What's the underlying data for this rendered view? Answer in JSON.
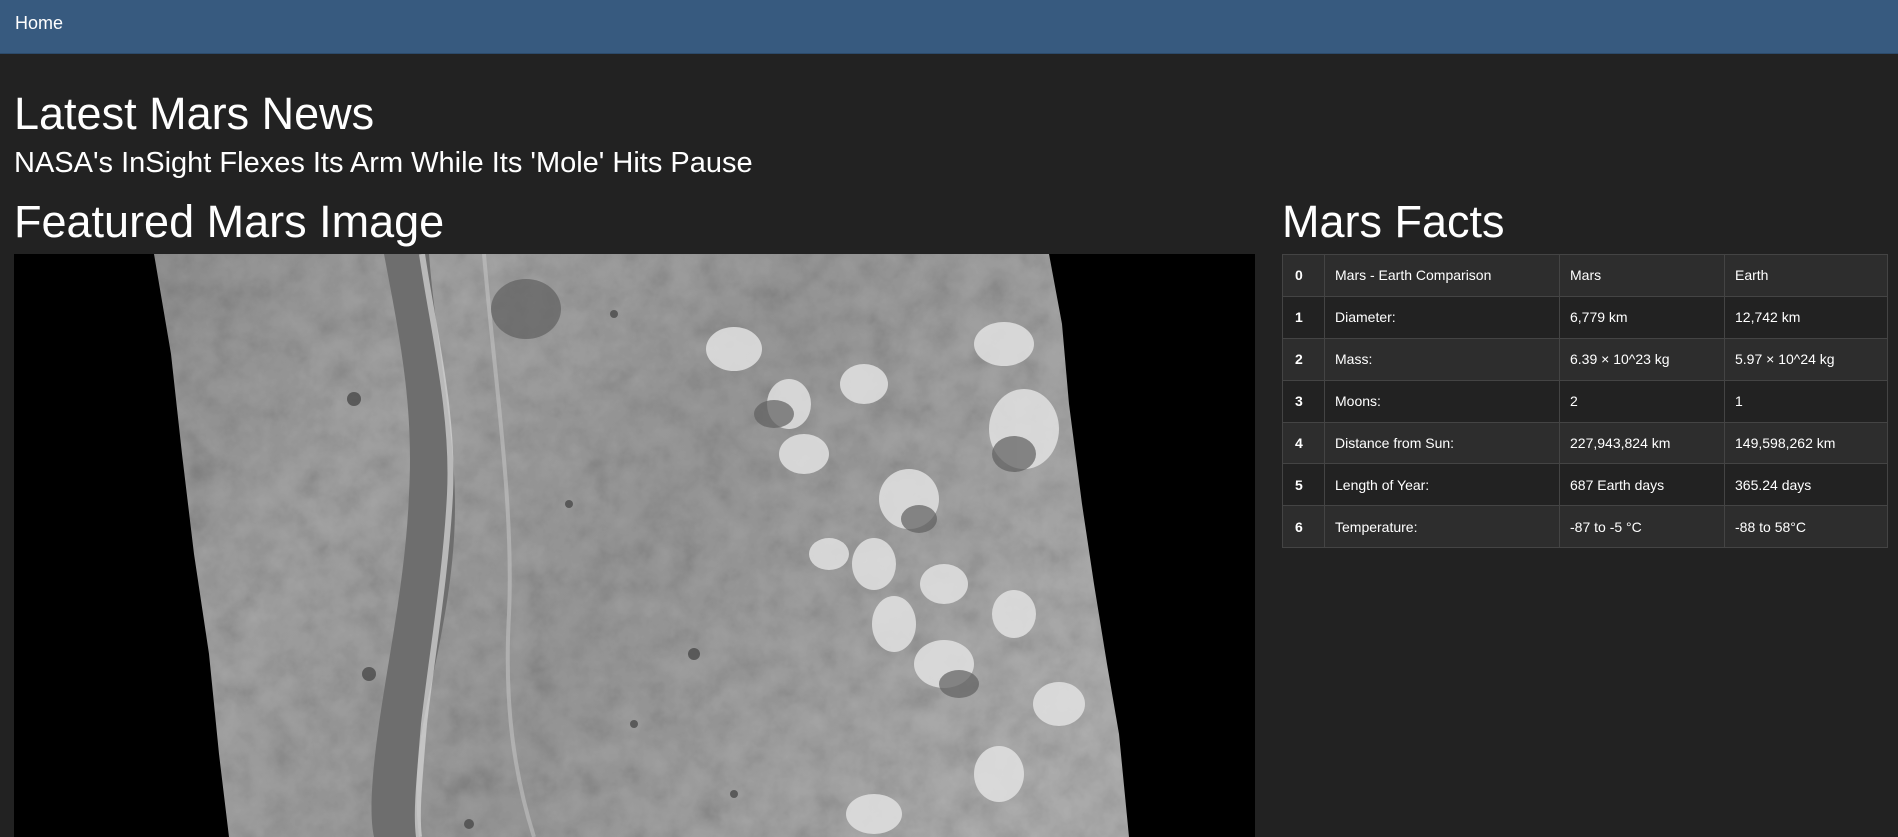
{
  "nav": {
    "home_label": "Home"
  },
  "news": {
    "heading": "Latest Mars News",
    "title": "NASA's InSight Flexes Its Arm While Its 'Mole' Hits Pause"
  },
  "featured": {
    "heading": "Featured Mars Image"
  },
  "facts": {
    "heading": "Mars Facts",
    "rows": [
      {
        "index": "0",
        "label": "Mars - Earth Comparison",
        "mars": "Mars",
        "earth": "Earth"
      },
      {
        "index": "1",
        "label": "Diameter:",
        "mars": "6,779 km",
        "earth": "12,742 km"
      },
      {
        "index": "2",
        "label": "Mass:",
        "mars": "6.39 × 10^23 kg",
        "earth": "5.97 × 10^24 kg"
      },
      {
        "index": "3",
        "label": "Moons:",
        "mars": "2",
        "earth": "1"
      },
      {
        "index": "4",
        "label": "Distance from Sun:",
        "mars": "227,943,824 km",
        "earth": "149,598,262 km"
      },
      {
        "index": "5",
        "label": "Length of Year:",
        "mars": "687 Earth days",
        "earth": "365.24 days"
      },
      {
        "index": "6",
        "label": "Temperature:",
        "mars": "-87 to -5 °C",
        "earth": "-88 to 58°C"
      }
    ]
  },
  "colors": {
    "navbar": "#375a7f",
    "background": "#222222",
    "table_stripe": "#2d2d2d",
    "table_border": "#444444"
  }
}
